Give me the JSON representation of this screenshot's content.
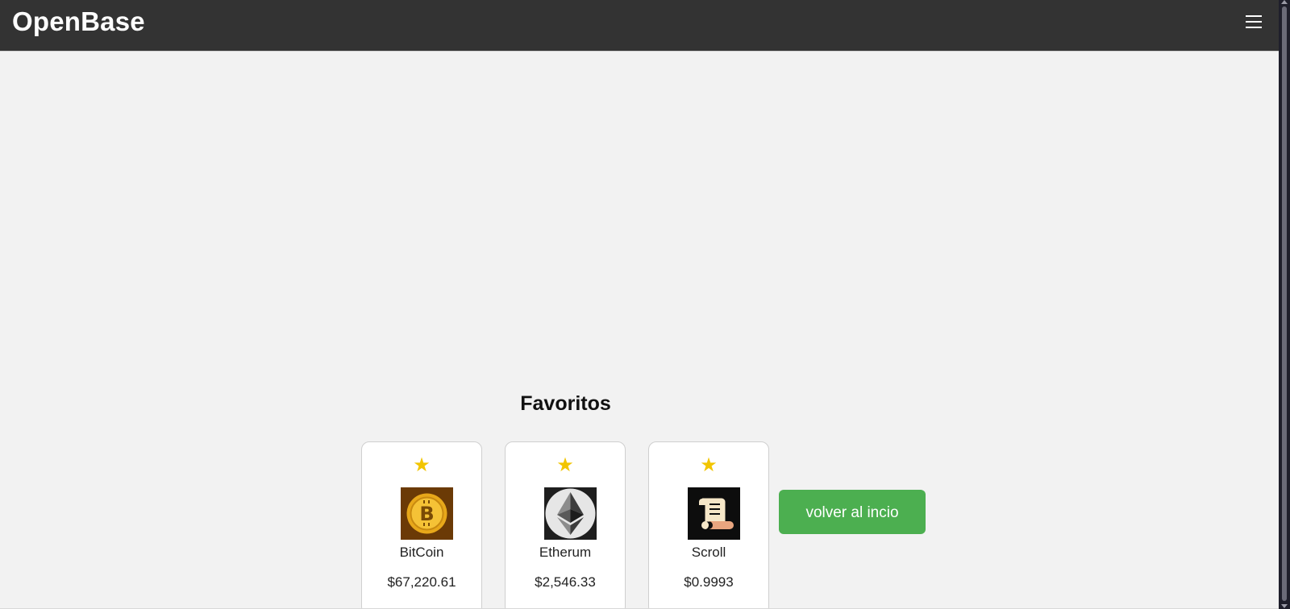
{
  "header": {
    "brand": "OpenBase",
    "menu_icon": "hamburger-menu-icon"
  },
  "favorites": {
    "title": "Favoritos",
    "cards": [
      {
        "name": "BitCoin",
        "price": "$67,220.61",
        "icon": "bitcoin-logo-icon",
        "star": "★"
      },
      {
        "name": "Etherum",
        "price": "$2,546.33",
        "icon": "ethereum-logo-icon",
        "star": "★"
      },
      {
        "name": "Scroll",
        "price": "$0.9993",
        "icon": "scroll-logo-icon",
        "star": "★"
      }
    ]
  },
  "back_button": {
    "label": "volver al incio"
  },
  "colors": {
    "header_bg": "#333333",
    "page_bg": "#f2f2f2",
    "star": "#f2c500",
    "button_bg": "#4caf50"
  }
}
